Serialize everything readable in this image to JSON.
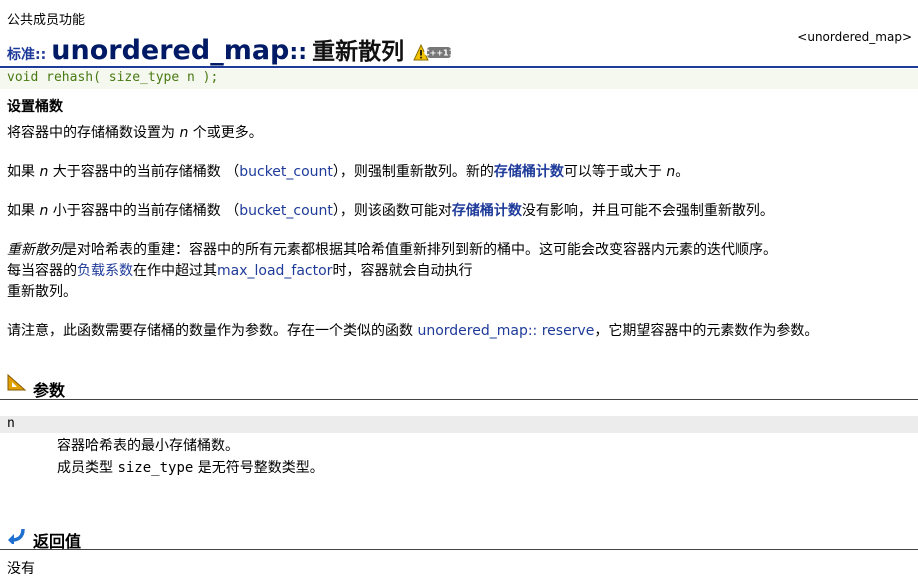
{
  "header": {
    "kicker": "公共成员功能",
    "reference": "<unordered_map>",
    "title_prefix": "标准::",
    "title_main": "unordered_map",
    "title_sep": "::",
    "title_method": "重新散列"
  },
  "prototype": "void rehash( size_type n );",
  "summary": {
    "heading": "设置桶数",
    "line": [
      "将容器中的存储桶数设置为 ",
      "n",
      " 个或更多。"
    ]
  },
  "para1": [
    "如果 ",
    "n",
    " 大于容器中的当前存储桶数 （",
    "bucket_count",
    "），则强制重新散列。新的",
    "存储桶计数",
    "可以等于或大于 ",
    "n",
    "。"
  ],
  "para2": [
    "如果 ",
    "n",
    " 小于容器中的当前存储桶数 （",
    "bucket_count",
    "），则该函数可能对",
    "存储桶计数",
    "没有影响，并且可能不会强制重新散列。"
  ],
  "para3": {
    "line1": [
      "重新散列",
      "是对哈希表的重建：容器中的所有元素都根据其哈希值重新排列到新的桶中。这可能会改变容器内元素的迭代顺序。"
    ],
    "line2": [
      "每当容器的",
      "负载系数",
      "在作中超过其",
      "max_load_factor",
      "时，容器就会自动执行"
    ],
    "line3": "重新散列。"
  },
  "para4": [
    "请注意，此函数需要存储桶的数量作为参数。存在一个类似的函数 ",
    "unordered_map:: reserve",
    "，它期望容器中的元素数作为参数。"
  ],
  "parameters": {
    "heading": "参数",
    "name": "n",
    "desc1": "容器哈希表的最小存储桶数。",
    "desc2": [
      "成员类型 ",
      "size_type",
      " 是无符号整数类型。"
    ]
  },
  "return_value": {
    "heading": "返回值",
    "text": "没有"
  },
  "colors": {
    "accent": "#1f3b9a",
    "title": "#001a66",
    "prototype": "#4a7a14"
  }
}
